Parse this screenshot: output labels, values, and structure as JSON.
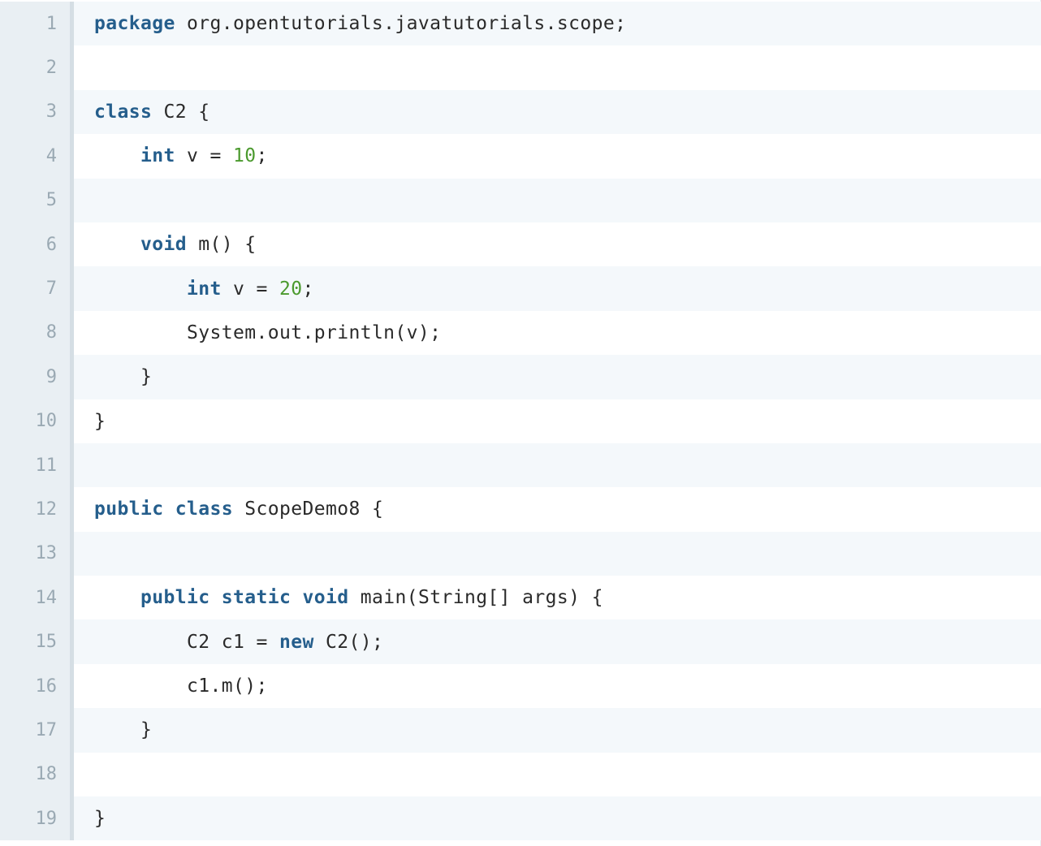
{
  "colors": {
    "keyword": "#255e8c",
    "number": "#4b9a2e",
    "text": "#2a2a2a",
    "gutter_bg": "#e9eff3",
    "line_number": "#9aa9b3",
    "row_alt": "#f4f8fb"
  },
  "code": {
    "lines": [
      {
        "number": "1",
        "indent": 0,
        "tokens": [
          {
            "t": "package",
            "k": "kw"
          },
          {
            "t": " org.opentutorials.javatutorials.scope;",
            "k": "plain"
          }
        ]
      },
      {
        "number": "2",
        "indent": 0,
        "tokens": []
      },
      {
        "number": "3",
        "indent": 0,
        "tokens": [
          {
            "t": "class",
            "k": "kw"
          },
          {
            "t": " C2 {",
            "k": "plain"
          }
        ]
      },
      {
        "number": "4",
        "indent": 1,
        "tokens": [
          {
            "t": "int",
            "k": "kw"
          },
          {
            "t": " v = ",
            "k": "plain"
          },
          {
            "t": "10",
            "k": "num"
          },
          {
            "t": ";",
            "k": "plain"
          }
        ]
      },
      {
        "number": "5",
        "indent": 0,
        "tokens": []
      },
      {
        "number": "6",
        "indent": 1,
        "tokens": [
          {
            "t": "void",
            "k": "kw"
          },
          {
            "t": " m() {",
            "k": "plain"
          }
        ]
      },
      {
        "number": "7",
        "indent": 2,
        "tokens": [
          {
            "t": "int",
            "k": "kw"
          },
          {
            "t": " v = ",
            "k": "plain"
          },
          {
            "t": "20",
            "k": "num"
          },
          {
            "t": ";",
            "k": "plain"
          }
        ]
      },
      {
        "number": "8",
        "indent": 2,
        "tokens": [
          {
            "t": "System.out.println(v);",
            "k": "plain"
          }
        ]
      },
      {
        "number": "9",
        "indent": 1,
        "tokens": [
          {
            "t": "}",
            "k": "plain"
          }
        ]
      },
      {
        "number": "10",
        "indent": 0,
        "tokens": [
          {
            "t": "}",
            "k": "plain"
          }
        ]
      },
      {
        "number": "11",
        "indent": 0,
        "tokens": []
      },
      {
        "number": "12",
        "indent": 0,
        "tokens": [
          {
            "t": "public",
            "k": "kw"
          },
          {
            "t": " ",
            "k": "plain"
          },
          {
            "t": "class",
            "k": "kw"
          },
          {
            "t": " ScopeDemo8 {",
            "k": "plain"
          }
        ]
      },
      {
        "number": "13",
        "indent": 0,
        "tokens": []
      },
      {
        "number": "14",
        "indent": 1,
        "tokens": [
          {
            "t": "public",
            "k": "kw"
          },
          {
            "t": " ",
            "k": "plain"
          },
          {
            "t": "static",
            "k": "kw"
          },
          {
            "t": " ",
            "k": "plain"
          },
          {
            "t": "void",
            "k": "kw"
          },
          {
            "t": " main(String[] args) {",
            "k": "plain"
          }
        ]
      },
      {
        "number": "15",
        "indent": 2,
        "tokens": [
          {
            "t": "C2 c1 = ",
            "k": "plain"
          },
          {
            "t": "new",
            "k": "kw"
          },
          {
            "t": " C2();",
            "k": "plain"
          }
        ]
      },
      {
        "number": "16",
        "indent": 2,
        "tokens": [
          {
            "t": "c1.m();",
            "k": "plain"
          }
        ]
      },
      {
        "number": "17",
        "indent": 1,
        "tokens": [
          {
            "t": "}",
            "k": "plain"
          }
        ]
      },
      {
        "number": "18",
        "indent": 0,
        "tokens": []
      },
      {
        "number": "19",
        "indent": 0,
        "tokens": [
          {
            "t": "}",
            "k": "plain"
          }
        ]
      }
    ]
  }
}
